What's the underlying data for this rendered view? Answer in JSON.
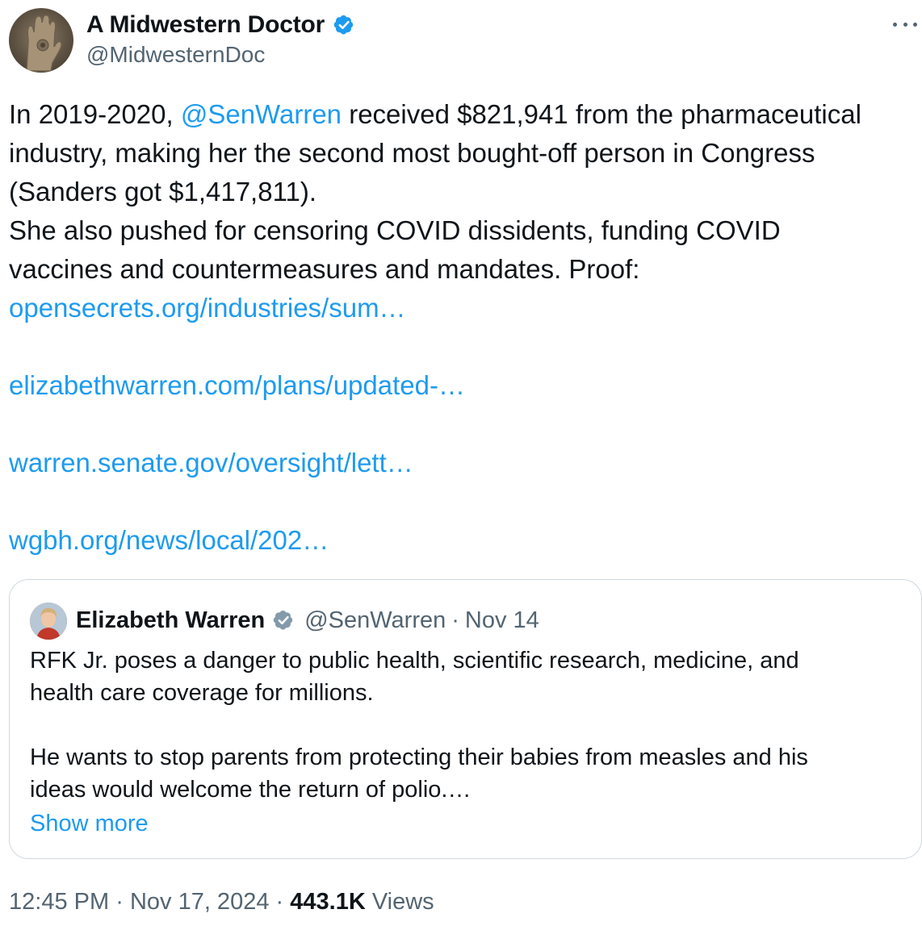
{
  "author": {
    "name": "A Midwestern Doctor",
    "handle": "@MidwesternDoc",
    "avatar_icon": "hand-sculpture-avatar",
    "verified_color": "#1d9bf0"
  },
  "tweet": {
    "lines": [
      {
        "before": "In 2019-2020, ",
        "mention": "@SenWarren",
        "after": " received $821,941 from the pharmaceutical"
      },
      {
        "text": "industry, making her the second most bought-off person in Congress"
      },
      {
        "text": "(Sanders got $1,417,811)."
      },
      {
        "text": "She also pushed for censoring COVID dissidents, funding COVID"
      },
      {
        "text": "vaccines and countermeasures and mandates. Proof:"
      }
    ],
    "links": [
      "opensecrets.org/industries/sum…",
      "elizabethwarren.com/plans/updated-…",
      "warren.senate.gov/oversight/lett…",
      "wgbh.org/news/local/202…"
    ]
  },
  "quote": {
    "name": "Elizabeth Warren",
    "handle": "@SenWarren",
    "separator": "·",
    "date": "Nov 14",
    "verified_color": "#829aab",
    "paragraph1": [
      "RFK Jr. poses a danger to public health, scientific research, medicine, and",
      "health care coverage for millions."
    ],
    "paragraph2": [
      "He wants to stop parents from protecting their babies from measles and his",
      "ideas would welcome the return of polio.…"
    ],
    "show_more": "Show more"
  },
  "footer": {
    "time": "12:45 PM",
    "separator": "·",
    "date": "Nov 17, 2024",
    "views_count": "443.1K",
    "views_label": "Views"
  },
  "colors": {
    "link": "#1d9bf0",
    "text": "#0f1419",
    "secondary": "#536471",
    "border": "#cfd9de"
  }
}
